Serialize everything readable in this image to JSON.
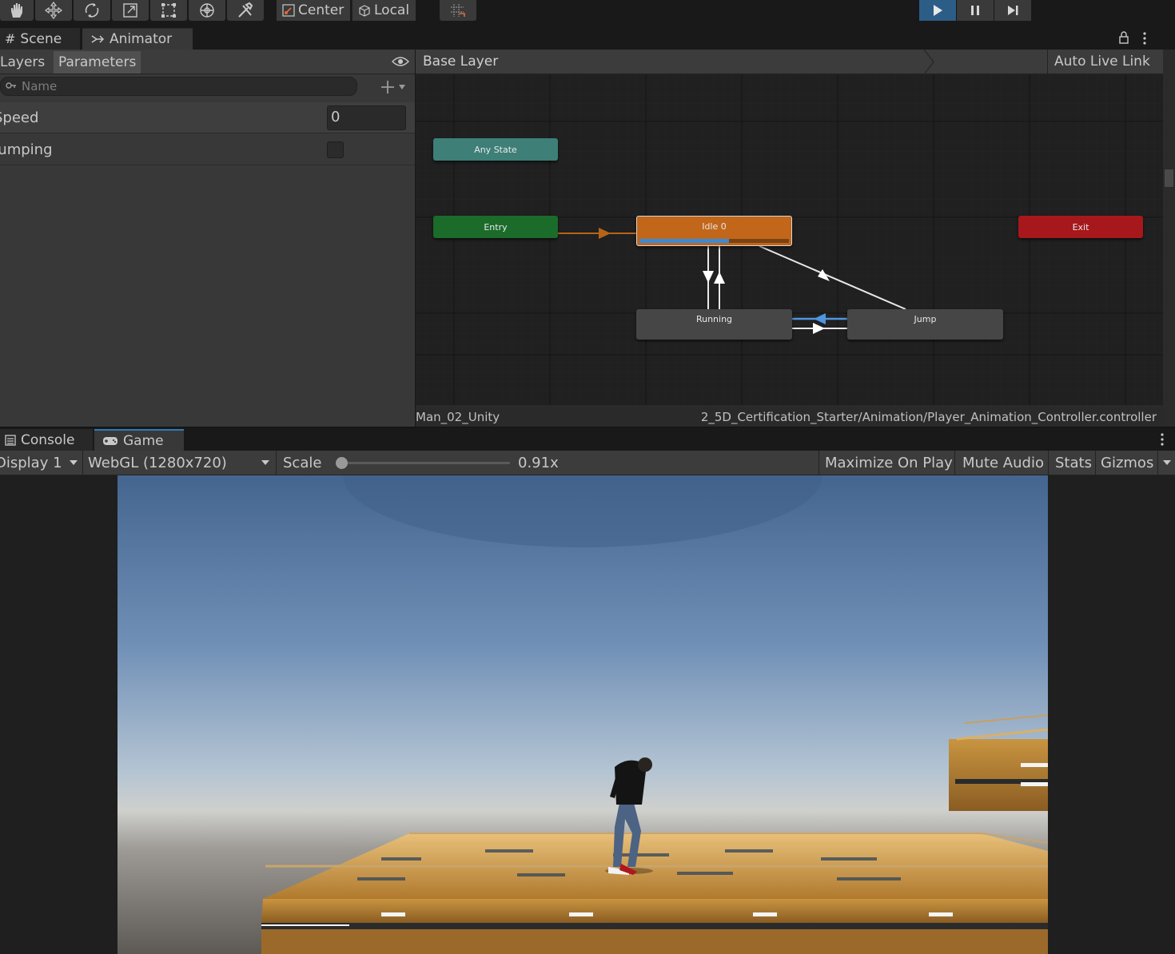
{
  "toolbar": {
    "tools": [
      "hand-tool",
      "move-tool",
      "rotate-tool",
      "scale-tool",
      "rect-tool",
      "transform-tool",
      "custom-tool"
    ],
    "pivot_label": "Center",
    "space_label": "Local"
  },
  "tabs_top": {
    "scene": "Scene",
    "animator": "Animator"
  },
  "animator": {
    "layers_tab": "Layers",
    "parameters_tab": "Parameters",
    "search_placeholder": "Name",
    "parameters": [
      {
        "name": "Speed",
        "type": "float",
        "value": "0"
      },
      {
        "name": "Jumping",
        "type": "bool",
        "value": false
      }
    ],
    "breadcrumb": "Base Layer",
    "auto_live_link": "Auto Live Link",
    "states": {
      "any_state": "Any State",
      "entry": "Entry",
      "idle": "Idle 0",
      "exit": "Exit",
      "running": "Running",
      "jump": "Jump"
    },
    "idle_progress": 0.6,
    "status_left": "Man_02_Unity",
    "status_right": "2_5D_Certification_Starter/Animation/Player_Animation_Controller.controller",
    "colors": {
      "any_state": "#3e7f78",
      "entry": "#1b6b2a",
      "idle": "#c2661a",
      "exit": "#a6181b",
      "normal": "#464646",
      "progress": "#3a8ad8",
      "active_transition": "#4f95e0"
    }
  },
  "tabs_bottom": {
    "console": "Console",
    "game": "Game"
  },
  "game": {
    "display": "Display 1",
    "resolution": "WebGL (1280x720)",
    "scale_label": "Scale",
    "scale_value": "0.91x",
    "scale_fraction": 0.0,
    "maximize": "Maximize On Play",
    "mute": "Mute Audio",
    "stats": "Stats",
    "gizmos": "Gizmos"
  }
}
